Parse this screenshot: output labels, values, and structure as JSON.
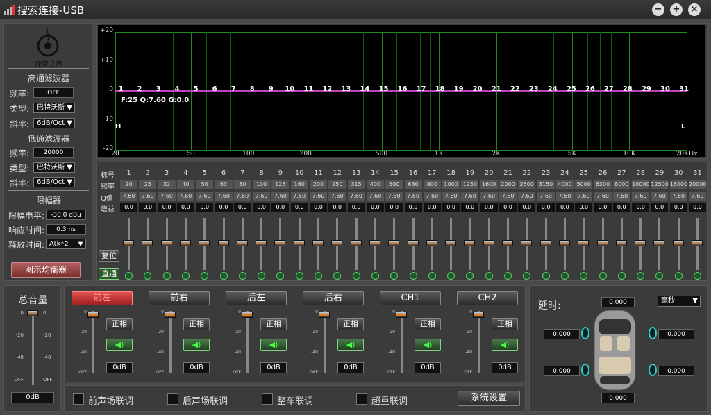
{
  "window": {
    "title": "搜索连接-USB"
  },
  "brand": {
    "name": "戏音之声"
  },
  "highpass": {
    "title": "高通滤波器",
    "freq_label": "频率:",
    "freq": "OFF",
    "type_label": "类型:",
    "type": "巴特沃斯",
    "slope_label": "斜率:",
    "slope": "6dB/Oct"
  },
  "lowpass": {
    "title": "低通滤波器",
    "freq_label": "频率:",
    "freq": "20000",
    "type_label": "类型:",
    "type": "巴特沃斯",
    "slope_label": "斜率:",
    "slope": "6dB/Oct"
  },
  "limiter": {
    "title": "限幅器",
    "level_label": "限幅电平:",
    "level": "-30.0 dBu",
    "attack_label": "响应时间:",
    "attack": "0.3ms",
    "release_label": "释放时间:",
    "release": "Atk*2"
  },
  "graphic_eq_button": "图示均衡器",
  "plot": {
    "y_labels": [
      "+20",
      "+10",
      "0",
      "-10",
      "-20"
    ],
    "x_labels": [
      "20",
      "50",
      "100",
      "200",
      "500",
      "1K",
      "2K",
      "5K",
      "10K",
      "20KHz"
    ],
    "info": "F:25 Q:7.60 G:0.0",
    "high_marker": "H",
    "low_marker": "L"
  },
  "eq_table": {
    "row_labels": [
      "标号",
      "频率",
      "Q值",
      "增益"
    ],
    "freqs": [
      "20",
      "25",
      "32",
      "40",
      "50",
      "63",
      "80",
      "100",
      "125",
      "160",
      "200",
      "250",
      "315",
      "400",
      "500",
      "630",
      "800",
      "1000",
      "1250",
      "1600",
      "2000",
      "2500",
      "3150",
      "4000",
      "5000",
      "6300",
      "8000",
      "10000",
      "12500",
      "16000",
      "20000"
    ],
    "q": "7.60",
    "gain": "0.0",
    "reset_label": "复位",
    "direct_label": "直通"
  },
  "master": {
    "title": "总音量",
    "value": "0dB",
    "scale": [
      "0",
      "-20",
      "-40",
      "OFF"
    ]
  },
  "channels": [
    {
      "name": "前左",
      "phase": "正相",
      "value": "0dB"
    },
    {
      "name": "前右",
      "phase": "正相",
      "value": "0dB"
    },
    {
      "name": "后左",
      "phase": "正相",
      "value": "0dB"
    },
    {
      "name": "后右",
      "phase": "正相",
      "value": "0dB"
    },
    {
      "name": "CH1",
      "phase": "正相",
      "value": "0dB"
    },
    {
      "name": "CH2",
      "phase": "正相",
      "value": "0dB"
    }
  ],
  "channel_scale": [
    "0",
    "-20",
    "-40",
    "OFF"
  ],
  "links": [
    "前声场联调",
    "后声场联调",
    "整车联调",
    "超重联调"
  ],
  "system_settings": "系统设置",
  "delay": {
    "label": "延时:",
    "unit": "毫秒",
    "top": "0.000",
    "front_left": "0.000",
    "front_right": "0.000",
    "rear_left": "0.000",
    "rear_right": "0.000",
    "bottom": "0.000"
  },
  "colors": {
    "accent": "#e07a20",
    "curve": "#c040c0",
    "grid": "#1f8a1f",
    "active_channel": "#cc2a2a"
  }
}
